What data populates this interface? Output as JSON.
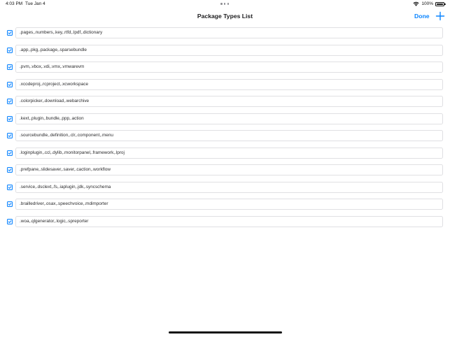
{
  "status_bar": {
    "time": "4:03 PM",
    "date": "Tue Jan 4",
    "battery": "100%"
  },
  "nav": {
    "title": "Package Types List",
    "done_label": "Done",
    "add_icon": "plus-icon"
  },
  "rows": [
    {
      "checked": true,
      "value": ".pages,.numbers,.key,.rtfd,.lpdf,.dictionary"
    },
    {
      "checked": true,
      "value": ".app,.pkg,.package,.sparsebundle"
    },
    {
      "checked": true,
      "value": ".pvm,.vbox,.vdi,.vmx,.vmwarevm"
    },
    {
      "checked": true,
      "value": ".xcodeproj,.rcproject,.xcworkspace"
    },
    {
      "checked": true,
      "value": ".colorpicker,.download,.webarchive"
    },
    {
      "checked": true,
      "value": ".kext,.plugin,.bundle,.ppp,.action"
    },
    {
      "checked": true,
      "value": ".sourcebundle,.definition,.clr,.component,.menu"
    },
    {
      "checked": true,
      "value": ".loginplugin,.ccl,.dylib,.monitorpanel,.framework,.lproj"
    },
    {
      "checked": true,
      "value": ".prefpane,.slidesaver,.saver,.caction,.workflow"
    },
    {
      "checked": true,
      "value": ".service,.dsclext,.fs,.iaplugin,.jdk,.syncschema"
    },
    {
      "checked": true,
      "value": ".brailledriver,.osax,.speechvoice,.mdimporter"
    },
    {
      "checked": true,
      "value": ".woa,.qlgenerator,.logic,.spreporter"
    }
  ],
  "colors": {
    "accent": "#0a84ff",
    "field_border": "#e0e0e3",
    "background": "#ffffff"
  }
}
